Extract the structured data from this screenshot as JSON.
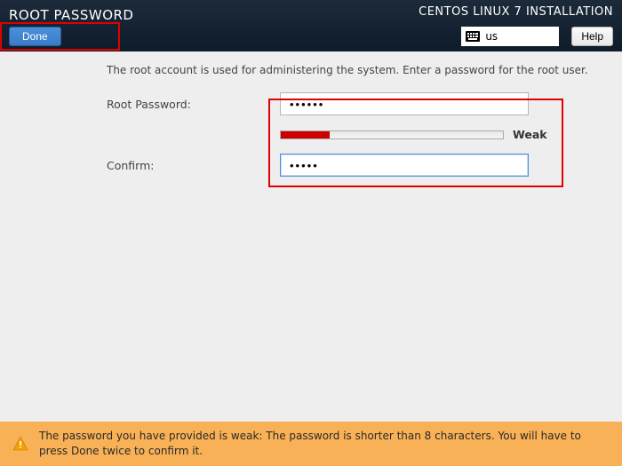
{
  "header": {
    "title": "ROOT PASSWORD",
    "done_label": "Done",
    "branding": "CENTOS LINUX 7 INSTALLATION",
    "keyboard_layout": "us",
    "help_label": "Help"
  },
  "form": {
    "instruction": "The root account is used for administering the system.  Enter a password for the root user.",
    "root_label": "Root Password:",
    "root_value": "••••••",
    "strength_label": "Weak",
    "confirm_label": "Confirm:",
    "confirm_value": "•••••"
  },
  "warning": {
    "text": "The password you have provided is weak: The password is shorter than 8 characters. You will have to press Done twice to confirm it."
  }
}
